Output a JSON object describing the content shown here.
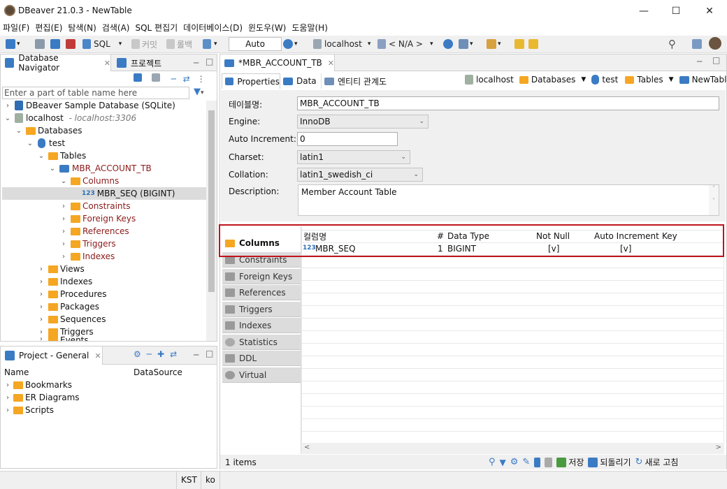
{
  "window": {
    "title": "DBeaver 21.0.3 - NewTable"
  },
  "menu": [
    "파일(F)",
    "편집(E)",
    "탐색(N)",
    "검색(A)",
    "SQL 편집기",
    "데이터베이스(D)",
    "윈도우(W)",
    "도움말(H)"
  ],
  "toolbar": {
    "sql_label": "SQL",
    "commit_label": "커밋",
    "rollback_label": "롤백",
    "mode_value": "Auto",
    "connection_label": "localhost",
    "schema_label": "< N/A >"
  },
  "navigator": {
    "tab_label": "Database Navigator",
    "tab2_label": "프로젝트",
    "filter_placeholder": "Enter a part of table name here",
    "tree": {
      "sample_db": "DBeaver Sample Database (SQLite)",
      "localhost": "localhost",
      "localhost_hint": "- localhost:3306",
      "databases": "Databases",
      "test": "test",
      "tables": "Tables",
      "table": "MBR_ACCOUNT_TB",
      "columns": "Columns",
      "column": "MBR_SEQ (BIGINT)",
      "column_badge": "123",
      "constraints": "Constraints",
      "foreign_keys": "Foreign Keys",
      "references": "References",
      "triggers": "Triggers",
      "indexes": "Indexes",
      "views": "Views",
      "indexes2": "Indexes",
      "procedures": "Procedures",
      "packages": "Packages",
      "sequences": "Sequences",
      "triggers2": "Triggers",
      "events": "Events"
    }
  },
  "project": {
    "tab_label": "Project - General",
    "col_name": "Name",
    "col_datasource": "DataSource",
    "items": [
      "Bookmarks",
      "ER Diagrams",
      "Scripts"
    ]
  },
  "editor": {
    "tab_label": "*MBR_ACCOUNT_TB",
    "subtabs": [
      "Properties",
      "Data",
      "엔티티 관계도"
    ],
    "breadcrumb": [
      "localhost",
      "Databases",
      "test",
      "Tables",
      "NewTable"
    ],
    "props": {
      "table_name_label": "테이블명:",
      "table_name": "MBR_ACCOUNT_TB",
      "engine_label": "Engine:",
      "engine": "InnoDB",
      "auto_inc_label": "Auto Increment:",
      "auto_inc": "0",
      "charset_label": "Charset:",
      "charset": "latin1",
      "collation_label": "Collation:",
      "collation": "latin1_swedish_ci",
      "description_label": "Description:",
      "description": "Member Account Table"
    },
    "side_tabs": [
      "Columns",
      "Constraints",
      "Foreign Keys",
      "References",
      "Triggers",
      "Indexes",
      "Statistics",
      "DDL",
      "Virtual"
    ],
    "grid": {
      "headers": [
        "컬럼명",
        "#",
        "Data Type",
        "Not Null",
        "Auto Increment",
        "Key"
      ],
      "rows": [
        {
          "badge": "123",
          "name": "MBR_SEQ",
          "num": "1",
          "type": "BIGINT",
          "notnull": "[v]",
          "autoinc": "[v]",
          "key": ""
        }
      ]
    },
    "footer": {
      "items_count": "1 items",
      "save_label": "저장",
      "revert_label": "되돌리기",
      "refresh_label": "새로 고침"
    }
  },
  "status": {
    "tz": "KST",
    "locale": "ko"
  },
  "colors": {
    "accent": "#2a6fb6",
    "highlight_border": "#c0141b",
    "folder": "#f5a623",
    "tree_red": "#8b1a1a"
  }
}
